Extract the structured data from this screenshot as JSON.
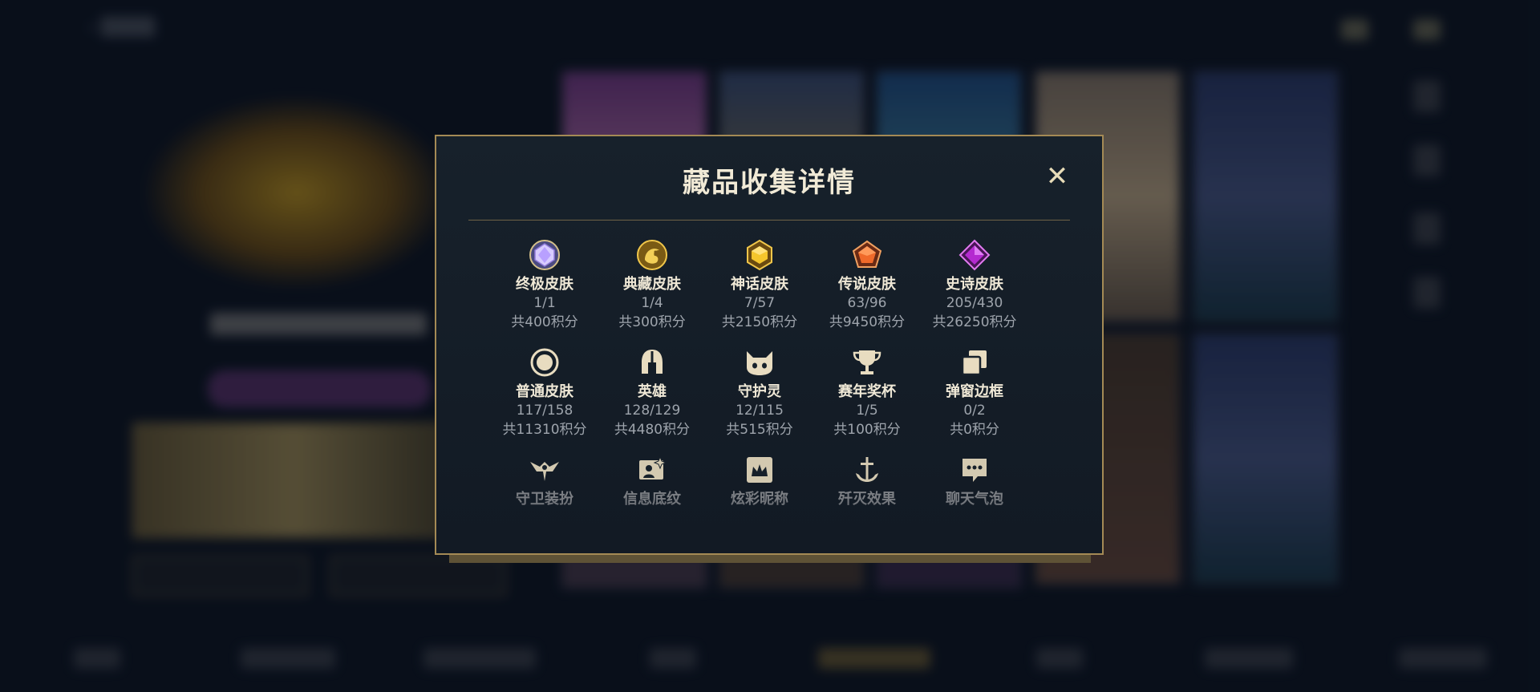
{
  "modal": {
    "title": "藏品收集详情",
    "close_symbol": "✕",
    "rows": [
      [
        {
          "icon": "ultimate-skin-gem-icon",
          "name": "终极皮肤",
          "count": "1/1",
          "points": "共400积分"
        },
        {
          "icon": "classic-skin-dragon-icon",
          "name": "典藏皮肤",
          "count": "1/4",
          "points": "共300积分"
        },
        {
          "icon": "mythic-skin-gem-icon",
          "name": "神话皮肤",
          "count": "7/57",
          "points": "共2150积分"
        },
        {
          "icon": "legendary-skin-gem-icon",
          "name": "传说皮肤",
          "count": "63/96",
          "points": "共9450积分"
        },
        {
          "icon": "epic-skin-gem-icon",
          "name": "史诗皮肤",
          "count": "205/430",
          "points": "共26250积分"
        }
      ],
      [
        {
          "icon": "normal-skin-circle-icon",
          "name": "普通皮肤",
          "count": "117/158",
          "points": "共11310积分"
        },
        {
          "icon": "hero-helmet-icon",
          "name": "英雄",
          "count": "128/129",
          "points": "共4480积分"
        },
        {
          "icon": "guardian-spirit-icon",
          "name": "守护灵",
          "count": "12/115",
          "points": "共515积分"
        },
        {
          "icon": "season-trophy-icon",
          "name": "赛年奖杯",
          "count": "1/5",
          "points": "共100积分"
        },
        {
          "icon": "popup-frame-icon",
          "name": "弹窗边框",
          "count": "0/2",
          "points": "共0积分"
        }
      ],
      [
        {
          "icon": "guard-outfit-icon",
          "name": "守卫装扮"
        },
        {
          "icon": "info-background-icon",
          "name": "信息底纹"
        },
        {
          "icon": "colorful-nickname-icon",
          "name": "炫彩昵称"
        },
        {
          "icon": "annihilation-effect-icon",
          "name": "歼灭效果"
        },
        {
          "icon": "chat-bubble-icon",
          "name": "聊天气泡"
        }
      ]
    ]
  },
  "colors": {
    "accent_gold": "#a48a55",
    "modal_bg": "#17212b",
    "text_primary": "#efe8d6",
    "text_secondary": "#9ea4ac"
  }
}
